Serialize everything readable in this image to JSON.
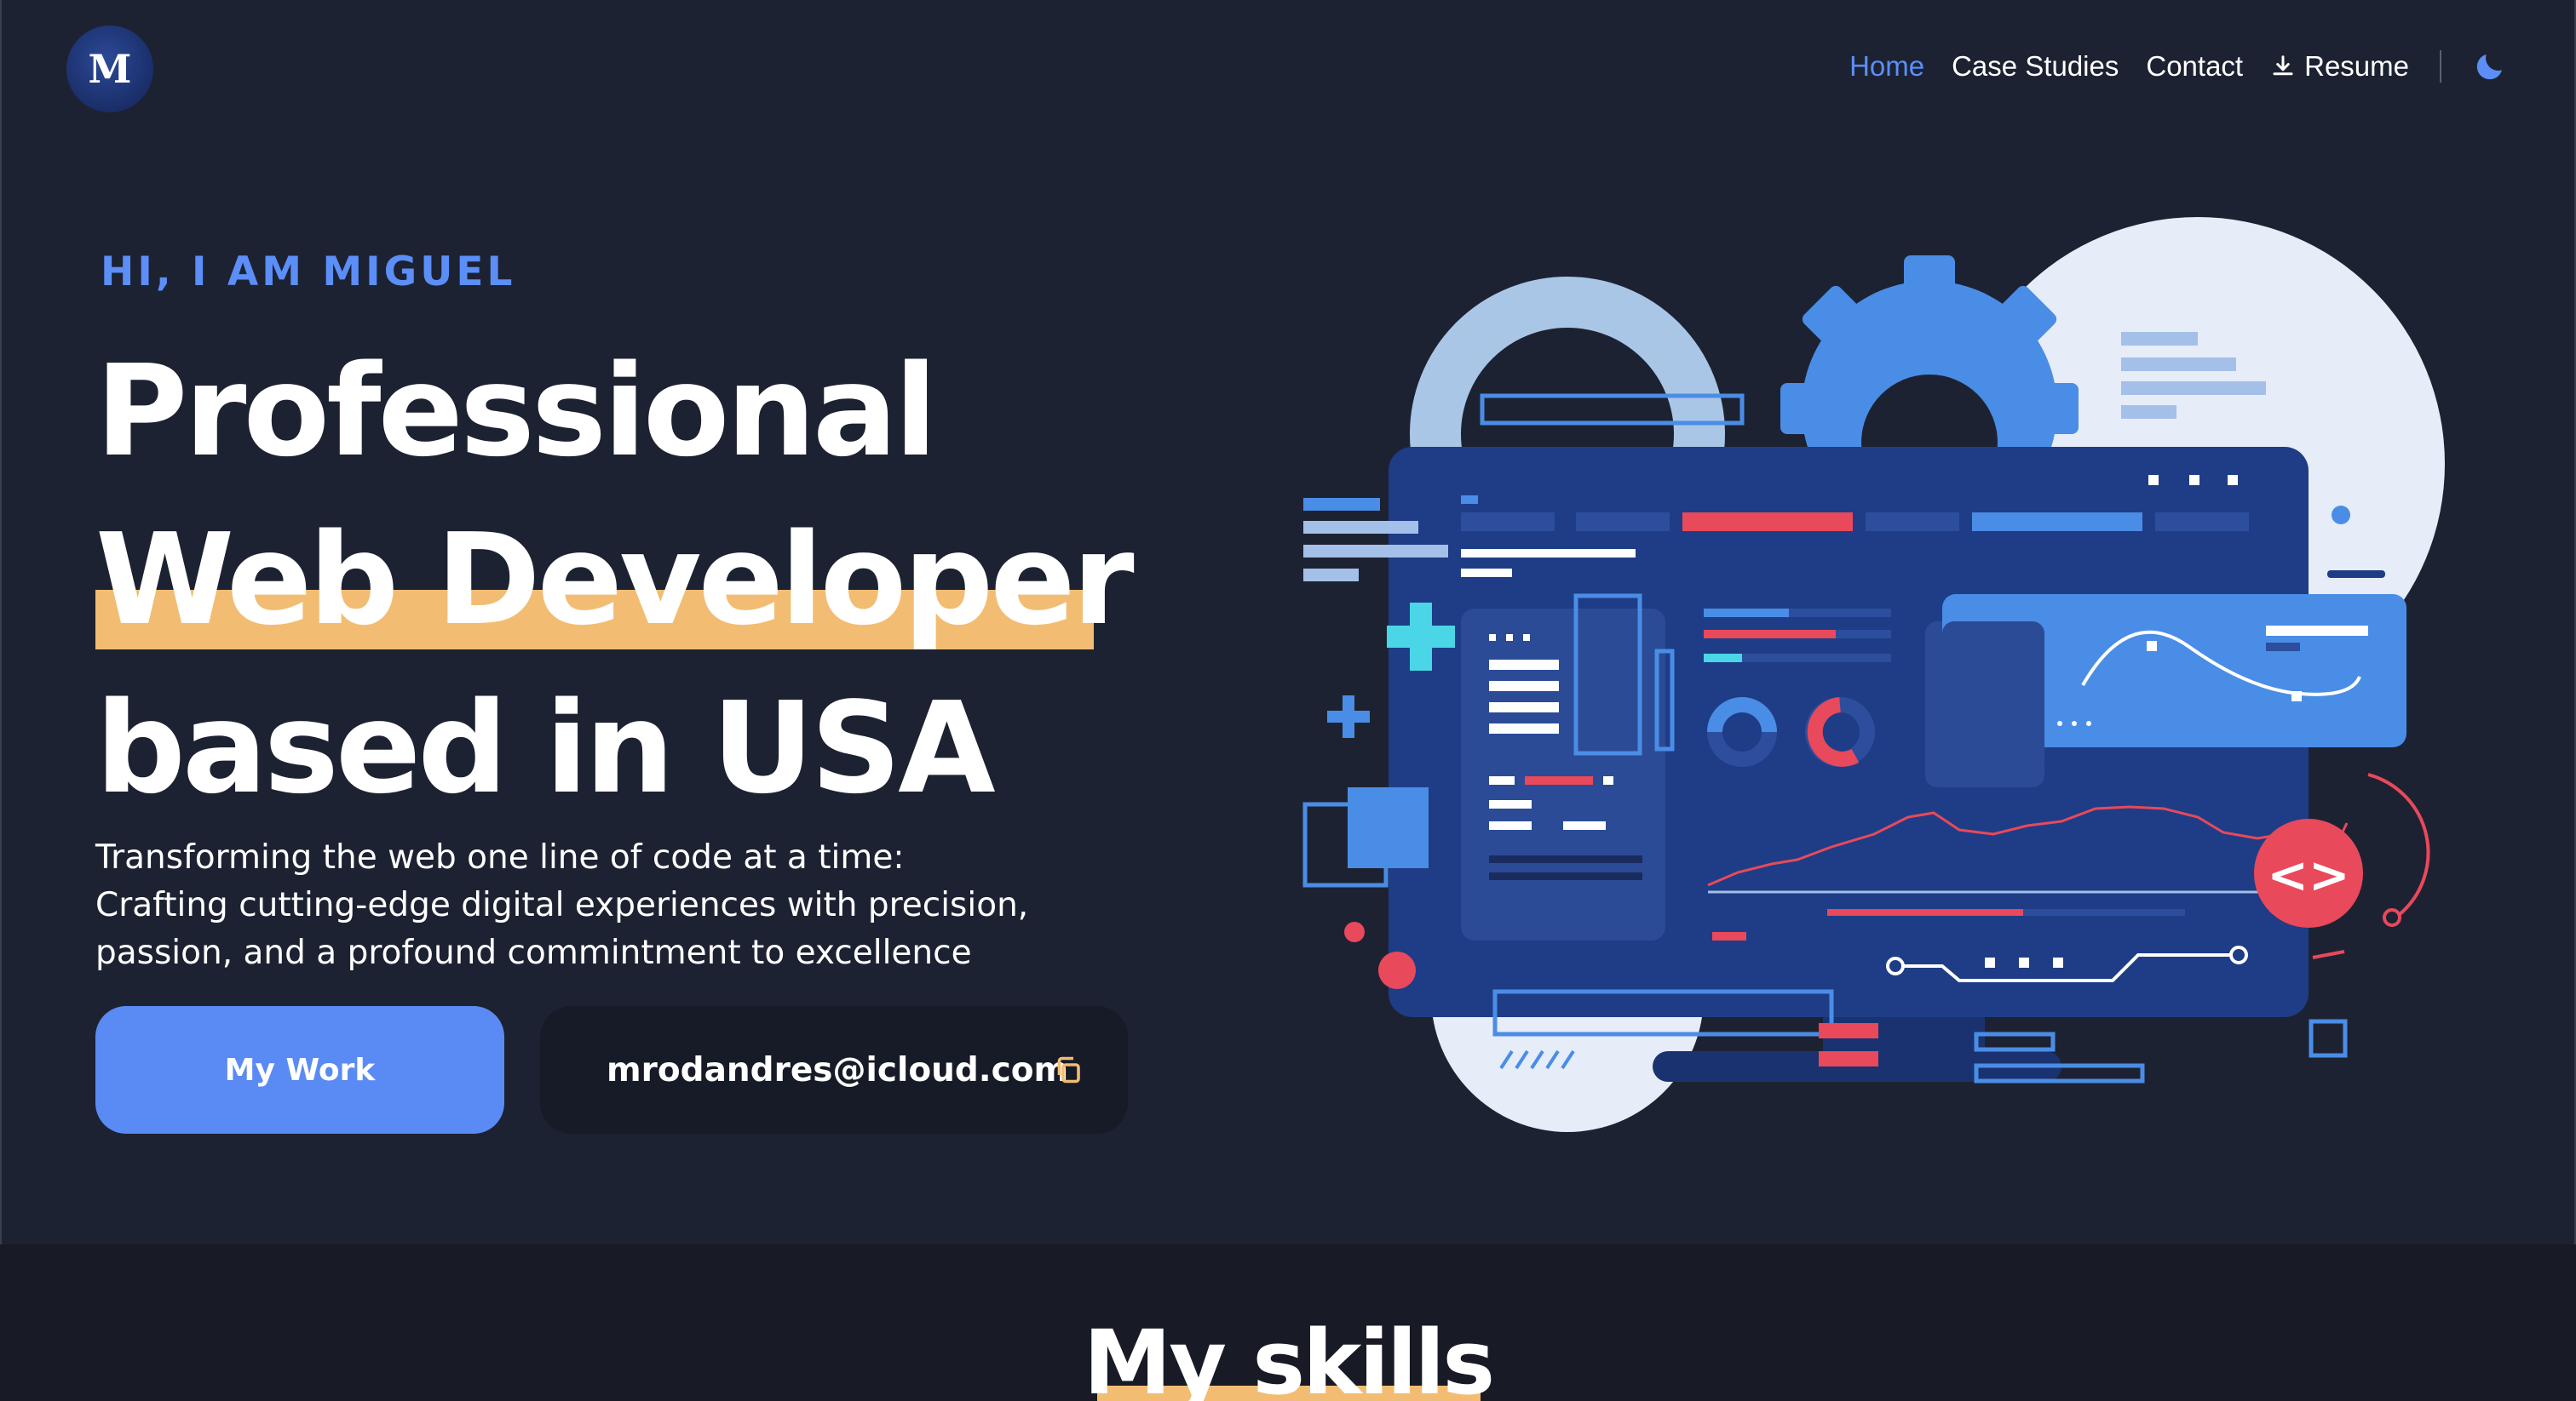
{
  "header": {
    "logo_text": "M",
    "nav": {
      "home": "Home",
      "case_studies": "Case Studies",
      "contact": "Contact",
      "resume": "Resume"
    },
    "theme_icon": "moon-icon"
  },
  "hero": {
    "kicker": "HI, I AM MIGUEL",
    "headline": {
      "line1": "Professional",
      "line2": "Web Developer",
      "line3": "based in USA"
    },
    "subtext": {
      "line1": "Transforming the web one line of code at a time:",
      "line2": "Crafting cutting-edge digital experiences with precision,",
      "line3": "passion, and a profound commintment to excellence"
    },
    "cta_label": "My Work",
    "email": "mrodandres@icloud.com",
    "illustration_code_badge": "<>"
  },
  "skills": {
    "title": "My skills"
  },
  "colors": {
    "background": "#1d2232",
    "accent_blue": "#5b8ef7",
    "highlight_yellow": "#f2bd72",
    "button_blue": "#5a8bf5",
    "email_box": "#171b27"
  }
}
